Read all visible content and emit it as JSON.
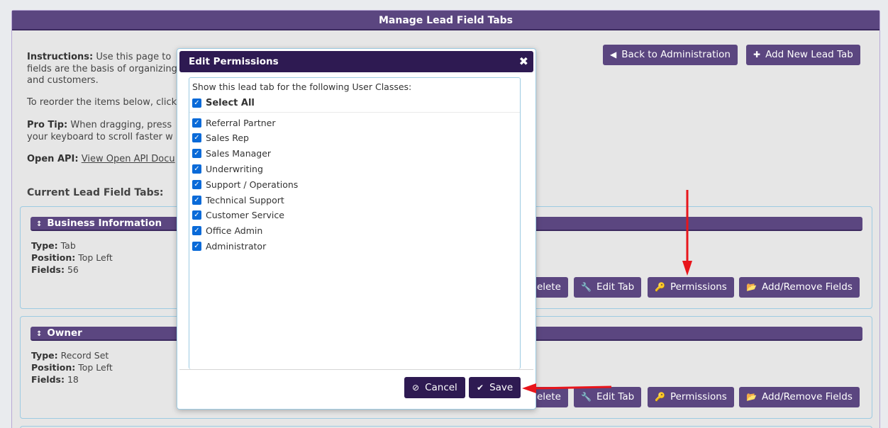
{
  "header": {
    "title": "Manage Lead Field Tabs"
  },
  "instructions": {
    "line1_label": "Instructions:",
    "line1_text": " Use this page to",
    "line2": "fields are the basis of organizing",
    "line3": "and customers.",
    "reorder": "To reorder the items below, click",
    "protip_label": "Pro Tip:",
    "protip_text": " When dragging, press",
    "protip_line2": "your keyboard to scroll faster w",
    "api_label": "Open API:",
    "api_link": "View Open API Docu"
  },
  "top_buttons": {
    "back": "Back to Administration",
    "add": "Add New Lead Tab"
  },
  "section_title": "Current Lead Field Tabs:",
  "tabs": [
    {
      "name": "Business Information",
      "type_label": "Type:",
      "type": "Tab",
      "position_label": "Position:",
      "position": "Top Left",
      "fields_label": "Fields:",
      "fields": "56"
    },
    {
      "name": "Owner",
      "type_label": "Type:",
      "type": "Record Set",
      "position_label": "Position:",
      "position": "Top Left",
      "fields_label": "Fields:",
      "fields": "18"
    }
  ],
  "tab_buttons": {
    "delete": "elete",
    "edit": "Edit Tab",
    "permissions": "Permissions",
    "fields": "Add/Remove Fields"
  },
  "modal": {
    "title": "Edit Permissions",
    "close": "✖",
    "intro": "Show this lead tab for the following User Classes:",
    "select_all": "Select All",
    "classes": [
      "Referral Partner",
      "Sales Rep",
      "Sales Manager",
      "Underwriting",
      "Support / Operations",
      "Technical Support",
      "Customer Service",
      "Office Admin",
      "Administrator"
    ],
    "cancel": "Cancel",
    "save": "Save"
  },
  "colors": {
    "header_purple": "#5b4680",
    "modal_dark": "#2e1a52",
    "checkbox_blue": "#0a6ad8",
    "annotation_red": "#e8151b"
  }
}
